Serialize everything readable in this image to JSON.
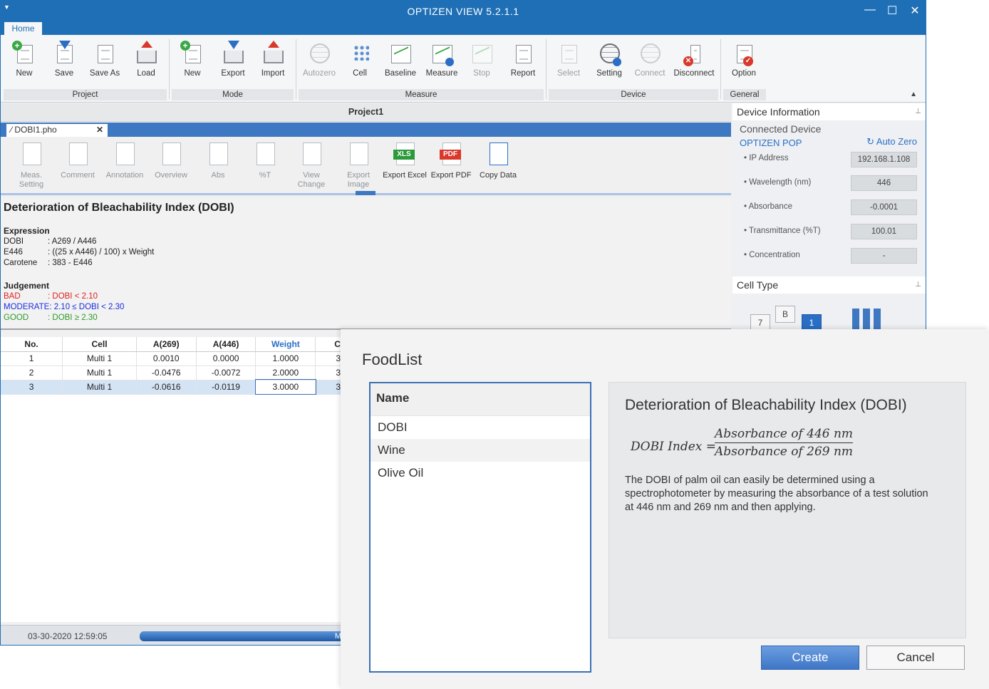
{
  "window": {
    "title": "OPTIZEN VIEW 5.2.1.1",
    "minimize": "—",
    "maximize": "☐",
    "close": "✕"
  },
  "ribbon": {
    "tab": "Home",
    "buttons": {
      "new": "New",
      "save": "Save",
      "save_as": "Save As",
      "load": "Load",
      "mode_new": "New",
      "export": "Export",
      "import": "Import",
      "autozero": "Autozero",
      "cell": "Cell",
      "baseline": "Baseline",
      "measure": "Measure",
      "stop": "Stop",
      "report": "Report",
      "select": "Select",
      "setting": "Setting",
      "connect": "Connect",
      "disconnect": "Disconnect",
      "option": "Option"
    },
    "groups": {
      "project": "Project",
      "mode": "Mode",
      "measure": "Measure",
      "device": "Device",
      "general": "General"
    }
  },
  "project": {
    "title": "Project1",
    "tab": "DOBI1.pho"
  },
  "toolbar": {
    "meas_setting": "Meas. Setting",
    "comment": "Comment",
    "annotation": "Annotation",
    "overview": "Overview",
    "abs": "Abs",
    "pt": "%T",
    "view_change": "View Change",
    "export_image": "Export Image",
    "export_excel": "Export Excel",
    "export_pdf": "Export PDF",
    "copy_data": "Copy Data",
    "xls_badge": "XLS",
    "pdf_badge": "PDF"
  },
  "method": {
    "title": "Deterioration of Bleachability Index (DOBI)",
    "expression_label": "Expression",
    "expressions": [
      {
        "k": "DOBI",
        "v": ": A269 / A446"
      },
      {
        "k": "E446",
        "v": ": ((25 x A446) / 100) x Weight"
      },
      {
        "k": "Carotene",
        "v": ": 383 - E446"
      }
    ],
    "judgement_label": "Judgement",
    "judgements": [
      {
        "k": "BAD",
        "v": ": DOBI < 2.10",
        "color": "#e02020"
      },
      {
        "k": "MODERATE",
        "v": ": 2.10 ≤ DOBI < 2.30",
        "color": "#1a2ee0"
      },
      {
        "k": "GOOD",
        "v": ": DOBI ≥ 2.30",
        "color": "#2a9a2a"
      }
    ]
  },
  "table": {
    "headers": [
      "No.",
      "Cell",
      "A(269)",
      "A(446)",
      "Weight",
      "C"
    ],
    "rows": [
      [
        "1",
        "Multi 1",
        "0.0010",
        "0.0000",
        "1.0000",
        "3"
      ],
      [
        "2",
        "Multi 1",
        "-0.0476",
        "-0.0072",
        "2.0000",
        "3"
      ],
      [
        "3",
        "Multi 1",
        "-0.0616",
        "-0.0119",
        "3.0000",
        "3"
      ]
    ]
  },
  "status": {
    "timestamp": "03-30-2020 12:59:05",
    "progress_text": "M"
  },
  "device": {
    "header": "Device Information",
    "connected_label": "Connected Device",
    "device_name": "OPTIZEN POP",
    "auto_zero": "Auto Zero",
    "props": [
      {
        "label": "• IP Address",
        "value": "192.168.1.108"
      },
      {
        "label": "• Wavelength (nm)",
        "value": "446"
      },
      {
        "label": "• Absorbance",
        "value": "-0.0001"
      },
      {
        "label": "• Transmittance (%T)",
        "value": "100.01"
      },
      {
        "label": "• Concentration",
        "value": "-"
      }
    ]
  },
  "cell_type": {
    "header": "Cell Type",
    "buttons": [
      "7",
      "B",
      "1"
    ]
  },
  "dialog": {
    "title": "FoodList",
    "list_header": "Name",
    "items": [
      "DOBI",
      "Wine",
      "Olive Oil"
    ],
    "detail_title": "Deterioration of Bleachability Index (DOBI)",
    "formula_lhs": "DOBI Index  =",
    "formula_num": "Absorbance of 446 nm",
    "formula_den": "Absorbance of 269 nm",
    "description": "The DOBI of palm oil can easily be determined using a spectrophotometer by measuring the absorbance of a test solution at 446 nm and 269 nm and then applying.",
    "create": "Create",
    "cancel": "Cancel"
  }
}
